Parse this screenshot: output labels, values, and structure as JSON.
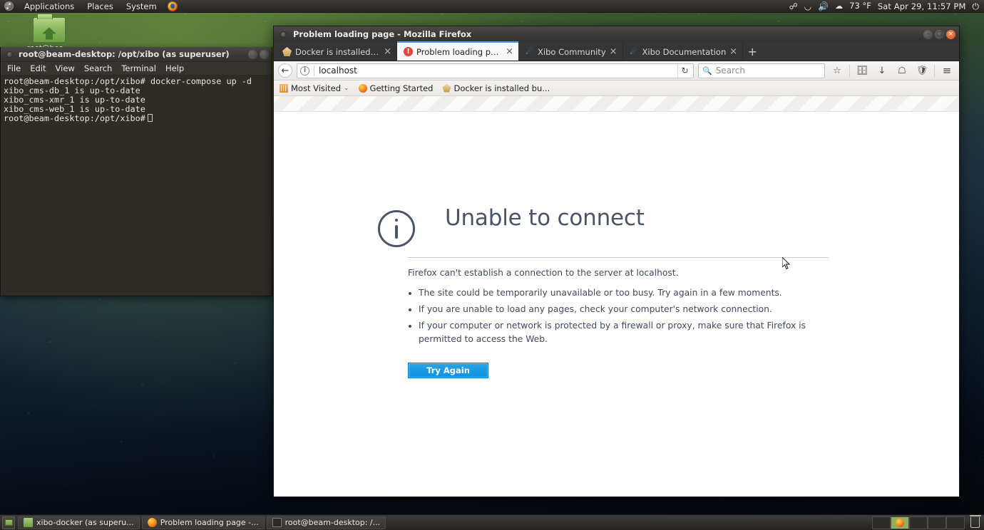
{
  "desktop": {
    "icon_label": "root@beam-desktop",
    "icon_name": "home-folder-icon"
  },
  "top_panel": {
    "logo": "ubuntu-logo-icon",
    "menus": [
      {
        "label": "Applications"
      },
      {
        "label": "Places"
      },
      {
        "label": "System"
      }
    ],
    "firefox_launcher": "firefox-icon",
    "tray": {
      "bluetooth": "ᛦ",
      "wifi": "wifi-icon",
      "volume": "volume-icon",
      "weather_icon": "cloud-icon",
      "temperature": "73 °F",
      "clock": "Sat Apr 29, 11:57 PM",
      "power": "⏻"
    }
  },
  "terminal": {
    "title": "root@beam-desktop: /opt/xibo (as superuser)",
    "menus": [
      "File",
      "Edit",
      "View",
      "Search",
      "Terminal",
      "Help"
    ],
    "lines": [
      "root@beam-desktop:/opt/xibo# docker-compose up -d",
      "xibo_cms-db_1 is up-to-date",
      "xibo_cms-xmr_1 is up-to-date",
      "xibo_cms-web_1 is up-to-date"
    ],
    "prompt": "root@beam-desktop:/opt/xibo#"
  },
  "firefox": {
    "window_title": "Problem loading page - Mozilla Firefox",
    "window_controls": {
      "minimize": "–",
      "maximize": "□",
      "close": "×"
    },
    "tabs": [
      {
        "label": "Docker is installed ...",
        "icon": "docker-icon",
        "active": false,
        "close": "×"
      },
      {
        "label": "Problem loading page",
        "icon": "error-icon",
        "active": true,
        "close": "×"
      },
      {
        "label": "Xibo Community",
        "icon": "xibo-icon",
        "active": false,
        "close": "×"
      },
      {
        "label": "Xibo Documentation",
        "icon": "xibo-icon",
        "active": false,
        "close": "×"
      }
    ],
    "new_tab": "+",
    "navbar": {
      "back": "←",
      "identity_icon": "i",
      "url": "localhost",
      "reload": "↻",
      "search_placeholder": "Search",
      "search_icon": "⌕",
      "bookmark_star": "☆",
      "library": "὜D",
      "downloads": "↓",
      "home": "⌂",
      "pocket": "▼",
      "menu": "≡"
    },
    "bookmarks": [
      {
        "label": "Most Visited",
        "icon": "folder-icon",
        "caret": "⌄"
      },
      {
        "label": "Getting Started",
        "icon": "firefox-icon",
        "caret": ""
      },
      {
        "label": "Docker is installed bu...",
        "icon": "docker-icon",
        "caret": ""
      }
    ]
  },
  "error_page": {
    "icon": "info-icon",
    "title": "Unable to connect",
    "lead": "Firefox can't establish a connection to the server at localhost.",
    "bullets": [
      "The site could be temporarily unavailable or too busy. Try again in a few moments.",
      "If you are unable to load any pages, check your computer's network connection.",
      "If your computer or network is protected by a firewall or proxy, make sure that Firefox is permitted to access the Web."
    ],
    "button_label": "Try Again",
    "button_color": "#1597e0"
  },
  "bottom_panel": {
    "show_desktop": "show-desktop-icon",
    "tasks": [
      {
        "label": "xibo-docker (as superu...",
        "icon": "folder-icon"
      },
      {
        "label": "Problem loading page -...",
        "icon": "firefox-icon"
      },
      {
        "label": "root@beam-desktop: /...",
        "icon": "terminal-icon"
      }
    ],
    "workspaces": [
      {
        "active": false,
        "content": ""
      },
      {
        "active": true,
        "content": "firefox-icon"
      },
      {
        "active": false,
        "content": ""
      },
      {
        "active": false,
        "content": ""
      },
      {
        "active": false,
        "content": ""
      }
    ],
    "trash": "trash-icon"
  }
}
